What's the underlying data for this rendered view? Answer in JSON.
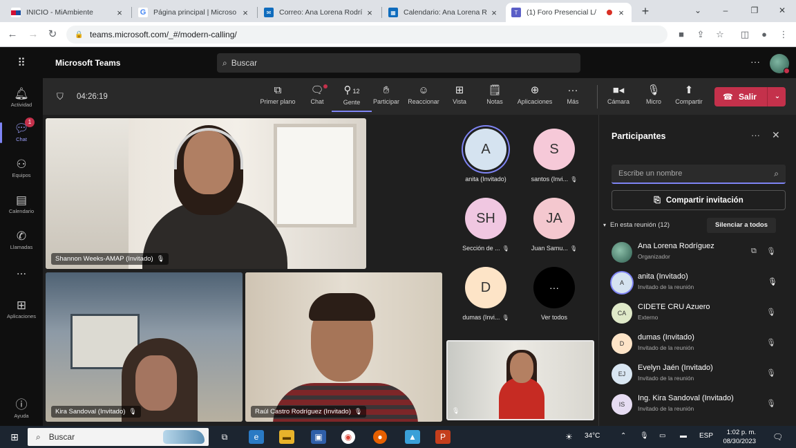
{
  "browser": {
    "tabs": [
      {
        "title": "INICIO - MiAmbiente",
        "favicon": "panama-flag-icon",
        "color": "#1a4fa0"
      },
      {
        "title": "Página principal | Microso",
        "favicon": "google-icon",
        "color": "#4285f4"
      },
      {
        "title": "Correo: Ana Lorena Rodrí",
        "favicon": "outlook-icon",
        "color": "#0f6cbd"
      },
      {
        "title": "Calendario: Ana Lorena R",
        "favicon": "calendar-icon",
        "color": "#0f6cbd"
      },
      {
        "title": "(1) Foro Presencial L/",
        "favicon": "teams-icon",
        "color": "#5b5fc7",
        "active": true
      }
    ],
    "url": "teams.microsoft.com/_#/modern-calling/"
  },
  "teams": {
    "brand": "Microsoft Teams",
    "search_placeholder": "Buscar"
  },
  "rail": [
    {
      "label": "Actividad",
      "icon": "bell-icon"
    },
    {
      "label": "Chat",
      "icon": "chat-icon",
      "badge": "1",
      "active": true
    },
    {
      "label": "Equipos",
      "icon": "teams-group-icon"
    },
    {
      "label": "Calendario",
      "icon": "calendar-icon"
    },
    {
      "label": "Llamadas",
      "icon": "phone-icon"
    },
    {
      "label": "...",
      "icon": "more-icon"
    },
    {
      "label": "Aplicaciones",
      "icon": "apps-icon"
    },
    {
      "label": "Ayuda",
      "icon": "help-icon"
    }
  ],
  "meeting": {
    "timer": "04:26:19",
    "toolbar": [
      {
        "label": "Primer plano",
        "icon": "spotlight-icon"
      },
      {
        "label": "Chat",
        "icon": "chat-icon"
      },
      {
        "label": "Gente",
        "icon": "people-icon",
        "count": "12",
        "selected": true
      },
      {
        "label": "Participar",
        "icon": "raise-hand-icon"
      },
      {
        "label": "Reaccionar",
        "icon": "emoji-icon"
      },
      {
        "label": "Vista",
        "icon": "view-icon"
      },
      {
        "label": "Notas",
        "icon": "notes-icon"
      },
      {
        "label": "Aplicaciones",
        "icon": "apps-add-icon"
      },
      {
        "label": "Más",
        "icon": "more-icon"
      },
      {
        "label": "Cámara",
        "icon": "camera-icon"
      },
      {
        "label": "Micro",
        "icon": "mic-off-icon"
      },
      {
        "label": "Compartir",
        "icon": "share-icon"
      }
    ],
    "leave_label": "Salir",
    "videos": [
      {
        "name": "Shannon Weeks-AMAP (Invitado)"
      },
      {
        "name": "Kira Sandoval (Invitado)"
      },
      {
        "name": "Raúl Castro Rodríguez (Invitado)"
      }
    ],
    "tiles": [
      {
        "initials": "A",
        "name": "anita (Invitado)",
        "color": "#d5e3f0",
        "selected": true
      },
      {
        "initials": "S",
        "name": "santos (Invi...",
        "color": "#f6c9d8",
        "muted": true
      },
      {
        "initials": "SH",
        "name": "Sección de ...",
        "color": "#f0c7e1",
        "muted": true
      },
      {
        "initials": "JA",
        "name": "Juan Samu...",
        "color": "#f4c8cf",
        "muted": true
      },
      {
        "initials": "D",
        "name": "dumas (Invi...",
        "color": "#fde4c7",
        "muted": true
      },
      {
        "initials": "···",
        "name": "Ver todos",
        "color": "#000000"
      }
    ]
  },
  "panel": {
    "title": "Participantes",
    "search_placeholder": "Escribe un nombre",
    "invite_label": "Compartir invitación",
    "section": "En esta reunión (12)",
    "mute_all": "Silenciar a todos",
    "participants": [
      {
        "initials": "",
        "name": "Ana Lorena Rodríguez",
        "role": "Organizador",
        "color": "#5a8f7e"
      },
      {
        "initials": "A",
        "name": "anita (Invitado)",
        "role": "Invitado de la reunión",
        "color": "#d5e3f0"
      },
      {
        "initials": "CA",
        "name": "CIDETE CRU Azuero",
        "role": "Externo",
        "color": "#dfe9c8"
      },
      {
        "initials": "D",
        "name": "dumas (Invitado)",
        "role": "Invitado de la reunión",
        "color": "#fde4c7"
      },
      {
        "initials": "EJ",
        "name": "Evelyn Jaén (Invitado)",
        "role": "Invitado de la reunión",
        "color": "#d9e6f2"
      },
      {
        "initials": "IS",
        "name": "Ing. Kira Sandoval (Invitado)",
        "role": "Invitado de la reunión",
        "color": "#e6dcf2"
      }
    ]
  },
  "taskbar": {
    "search": "Buscar",
    "weather": "34°C",
    "lang": "ESP",
    "time": "1:02 p. m.",
    "date": "08/30/2023"
  }
}
